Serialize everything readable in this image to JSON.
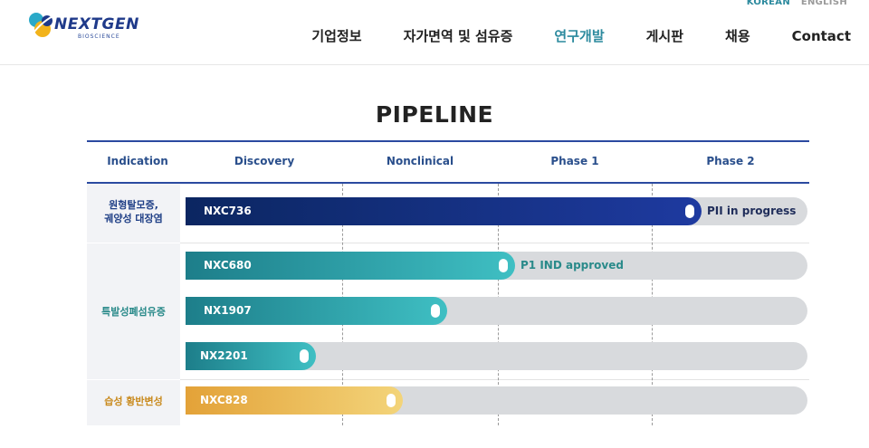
{
  "header": {
    "lang_korean": "KOREAN",
    "lang_english": "ENGLISH",
    "logo_text": "NEXTGEN",
    "logo_sub": "BIOSCIENCE",
    "nav": [
      {
        "label": "기업정보"
      },
      {
        "label": "자가면역 및 섬유증"
      },
      {
        "label": "연구개발"
      },
      {
        "label": "게시판"
      },
      {
        "label": "채용"
      },
      {
        "label": "Contact"
      }
    ],
    "active_nav": "연구개발"
  },
  "page": {
    "title": "PIPELINE"
  },
  "table": {
    "columns": [
      "Indication",
      "Discovery",
      "Nonclinical",
      "Phase 1",
      "Phase 2"
    ],
    "indications": [
      {
        "label_lines": [
          "원형탈모증,",
          "궤양성 대장염"
        ],
        "color": "#1f3f86"
      },
      {
        "label_lines": [
          "특발성폐섬유증"
        ],
        "color": "#2a8a8a"
      },
      {
        "label_lines": [
          "습성 황반변성"
        ],
        "color": "#c98a1d"
      }
    ],
    "programs": [
      {
        "name": "NXC736",
        "progress": 0.83,
        "status": "PII in progress",
        "colors": [
          "#0b2661",
          "#1e3aa0"
        ]
      },
      {
        "name": "NXC680",
        "progress": 0.53,
        "status": "P1 IND approved",
        "colors": [
          "#1d7e8a",
          "#3fbfc3"
        ]
      },
      {
        "name": "NX1907",
        "progress": 0.42,
        "status": "",
        "colors": [
          "#1d7e8a",
          "#3fbfc3"
        ]
      },
      {
        "name": "NX2201",
        "progress": 0.21,
        "status": "",
        "colors": [
          "#1d7e8a",
          "#3fbfc3"
        ]
      },
      {
        "name": "NXC828",
        "progress": 0.35,
        "status": "",
        "colors": [
          "#e3a238",
          "#f3d47a"
        ]
      }
    ]
  },
  "colors": {
    "accent": "#2c8a9e",
    "header_line": "#2b4aa0",
    "column_text": "#2a4f8c",
    "track": "#d8dadd"
  }
}
